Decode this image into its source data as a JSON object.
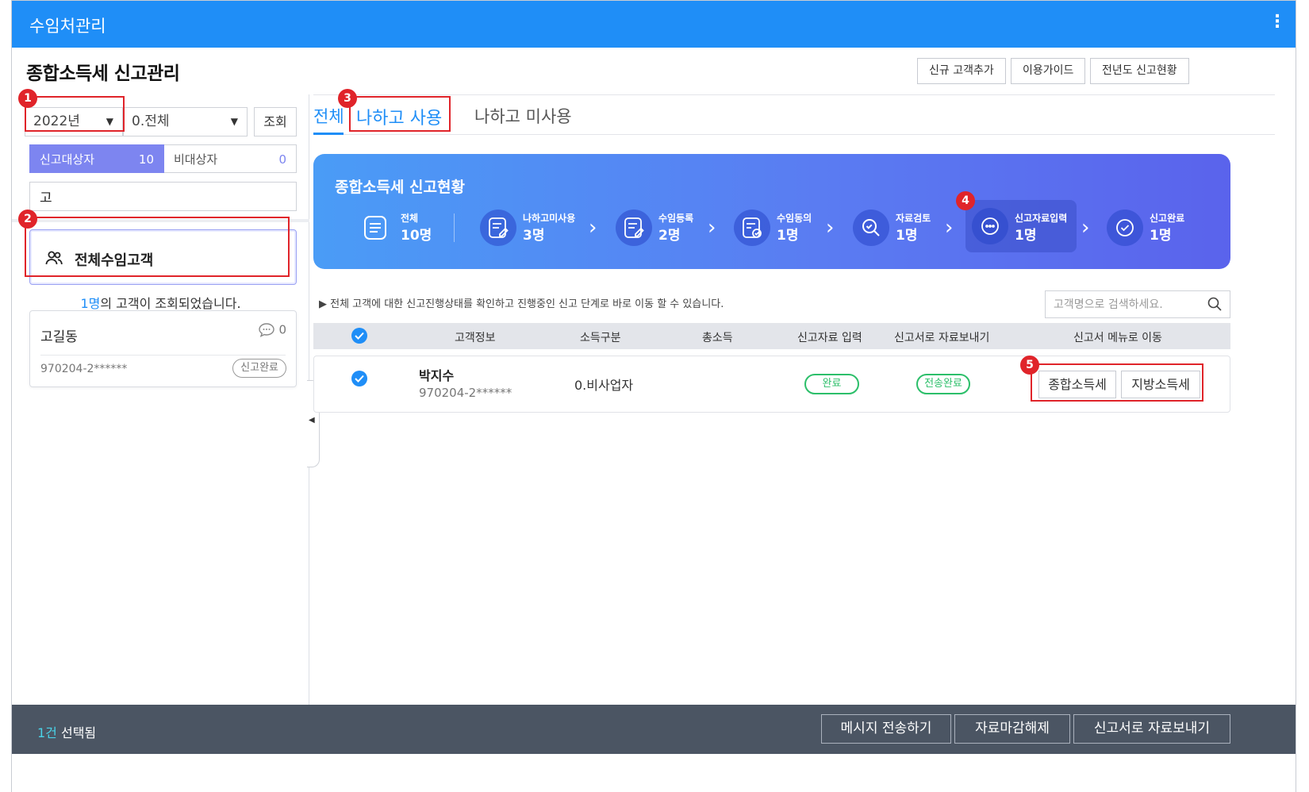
{
  "window": {
    "title": "수임처관리",
    "more_icon": "more-vertical-icon"
  },
  "page": {
    "title": "종합소득세 신고관리",
    "header_buttons": [
      "신규 고객추가",
      "이용가이드",
      "전년도 신고현황"
    ]
  },
  "filters": {
    "year": "2022년",
    "category": "0.전체",
    "query_button": "조회",
    "segments": [
      {
        "label": "신고대상자",
        "count": "10"
      },
      {
        "label": "비대상자",
        "count": "0"
      }
    ],
    "search_value": "고"
  },
  "group": {
    "label": "전체수임고객",
    "icon": "users-icon"
  },
  "result": {
    "count": "1명",
    "suffix": "의 고객이 조회되었습니다."
  },
  "customer_card": {
    "name": "고길동",
    "message_count": "0",
    "id": "970204-2******",
    "badge": "신고완료"
  },
  "tabs": [
    "전체",
    "나하고 사용",
    "나하고 미사용"
  ],
  "status": {
    "title": "종합소득세 신고현황",
    "steps": [
      {
        "label": "전체",
        "count": "10명",
        "icon": "list-doc-icon"
      },
      {
        "label": "나하고미사용",
        "count": "3명",
        "icon": "edit-doc-icon"
      },
      {
        "label": "수임등록",
        "count": "2명",
        "icon": "edit-doc-icon"
      },
      {
        "label": "수임동의",
        "count": "1명",
        "icon": "check-doc-icon"
      },
      {
        "label": "자료검토",
        "count": "1명",
        "icon": "search-icon"
      },
      {
        "label": "신고자료입력",
        "count": "1명",
        "icon": "dots-icon"
      },
      {
        "label": "신고완료",
        "count": "1명",
        "icon": "check-circle-icon"
      }
    ]
  },
  "guide_text": "▶ 전체 고객에 대한 신고진행상태를 확인하고 진행중인 신고 단계로 바로 이동 할 수 있습니다.",
  "search": {
    "placeholder": "고객명으로 검색하세요."
  },
  "table": {
    "headers": [
      "고객정보",
      "소득구분",
      "총소득",
      "신고자료 입력",
      "신고서로 자료보내기",
      "신고서 메뉴로 이동"
    ],
    "rows": [
      {
        "name": "박지수",
        "id": "970204-2******",
        "income_type": "0.비사업자",
        "total_income": "",
        "input_status": "완료",
        "send_status": "전송완료",
        "menu_buttons": [
          "종합소득세",
          "지방소득세"
        ]
      }
    ]
  },
  "markers": [
    "1",
    "2",
    "3",
    "4",
    "5"
  ],
  "footer": {
    "selected_count": "1건",
    "selected_suffix": " 선택됨",
    "buttons": [
      "메시지 전송하기",
      "자료마감해제",
      "신고서로 자료보내기"
    ]
  },
  "colors": {
    "primary": "#1f8ef7",
    "accent": "#7d85f0",
    "success": "#2cbf6a",
    "annotation": "#e0242a",
    "footer": "#4b5563"
  }
}
